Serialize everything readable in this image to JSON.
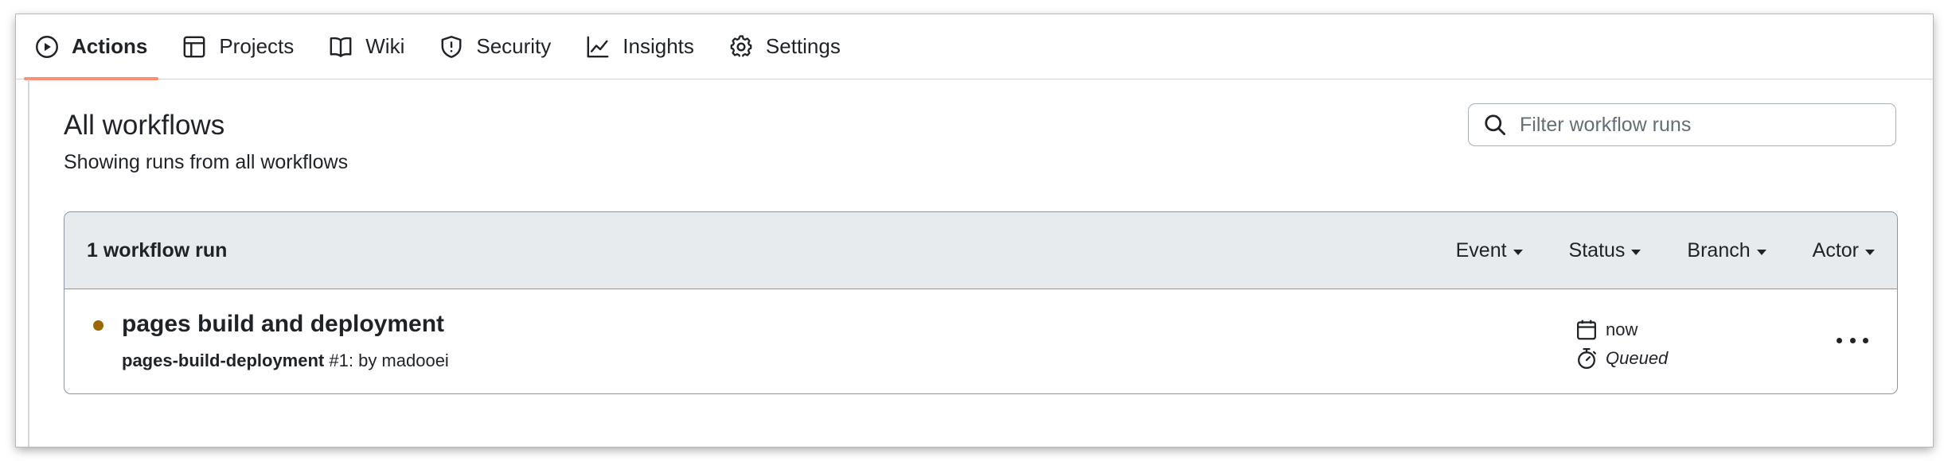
{
  "nav": {
    "tabs": [
      {
        "label": "Actions",
        "icon": "play-icon",
        "active": true
      },
      {
        "label": "Projects",
        "icon": "table-icon",
        "active": false
      },
      {
        "label": "Wiki",
        "icon": "book-icon",
        "active": false
      },
      {
        "label": "Security",
        "icon": "shield-icon",
        "active": false
      },
      {
        "label": "Insights",
        "icon": "graph-icon",
        "active": false
      },
      {
        "label": "Settings",
        "icon": "gear-icon",
        "active": false
      }
    ],
    "active_underline_color": "#fd8c73"
  },
  "header": {
    "title": "All workflows",
    "subtitle": "Showing runs from all workflows"
  },
  "search": {
    "placeholder": "Filter workflow runs",
    "value": ""
  },
  "runs": {
    "count_label": "1 workflow run",
    "filters": [
      "Event",
      "Status",
      "Branch",
      "Actor"
    ],
    "items": [
      {
        "title": "pages build and deployment",
        "workflow": "pages-build-deployment",
        "run_number": "#1",
        "meta_suffix": ": by madooei",
        "time": "now",
        "status": "Queued",
        "status_color": "#9a6700"
      }
    ]
  }
}
